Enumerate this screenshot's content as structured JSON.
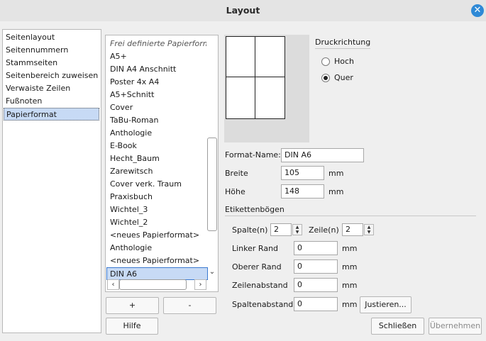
{
  "window": {
    "title": "Layout",
    "close_label": "✕"
  },
  "nav": {
    "items": [
      "Seitenlayout",
      "Seitennummern",
      "Stammseiten",
      "Seitenbereich zuweisen",
      "Verwaiste Zeilen",
      "Fußnoten",
      "Papierformat"
    ],
    "selected_index": 6
  },
  "paper_list": {
    "items": [
      "Frei definierte Papierformate",
      "A5+",
      "DIN A4 Anschnitt",
      "Poster 4x A4",
      "A5+Schnitt",
      "Cover",
      "TaBu-Roman",
      "Anthologie",
      "E-Book",
      "Hecht_Baum",
      "Zarewitsch",
      "Cover verk. Traum",
      "Praxisbuch",
      "Wichtel_3",
      "Wichtel_2",
      "<neues Papierformat>",
      "Anthologie",
      "<neues Papierformat>",
      "DIN A6"
    ],
    "selected": "DIN A6",
    "add_label": "+",
    "remove_label": "-"
  },
  "orientation": {
    "heading": "Druckrichtung",
    "portrait_label": "Hoch",
    "landscape_label": "Quer",
    "selected": "Quer"
  },
  "format": {
    "name_label": "Format-Name:",
    "name_value": "DIN A6",
    "width_label": "Breite",
    "width_value": "105",
    "height_label": "Höhe",
    "height_value": "148",
    "unit": "mm"
  },
  "labels": {
    "heading": "Etikettenbögen",
    "columns_label": "Spalte(n)",
    "columns_value": "2",
    "rows_label": "Zeile(n)",
    "rows_value": "2",
    "left_margin_label": "Linker Rand",
    "left_margin_value": "0",
    "top_margin_label": "Oberer Rand",
    "top_margin_value": "0",
    "row_spacing_label": "Zeilenabstand",
    "row_spacing_value": "0",
    "col_spacing_label": "Spaltenabstand",
    "col_spacing_value": "0",
    "unit": "mm",
    "adjust_label": "Justieren..."
  },
  "footer": {
    "help_label": "Hilfe",
    "close_label": "Schließen",
    "apply_label": "Übernehmen"
  }
}
